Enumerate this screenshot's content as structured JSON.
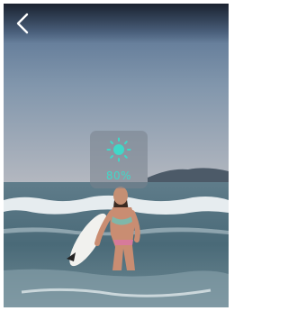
{
  "viewer": {
    "brightness_value": "80%",
    "brightness_level": 0.8
  },
  "icons": {
    "back": "chevron-left-icon",
    "brightness": "sun-icon"
  },
  "colors": {
    "accent": "#40d8c8",
    "panel": "#6a7278",
    "topbar": "#1a2230"
  }
}
